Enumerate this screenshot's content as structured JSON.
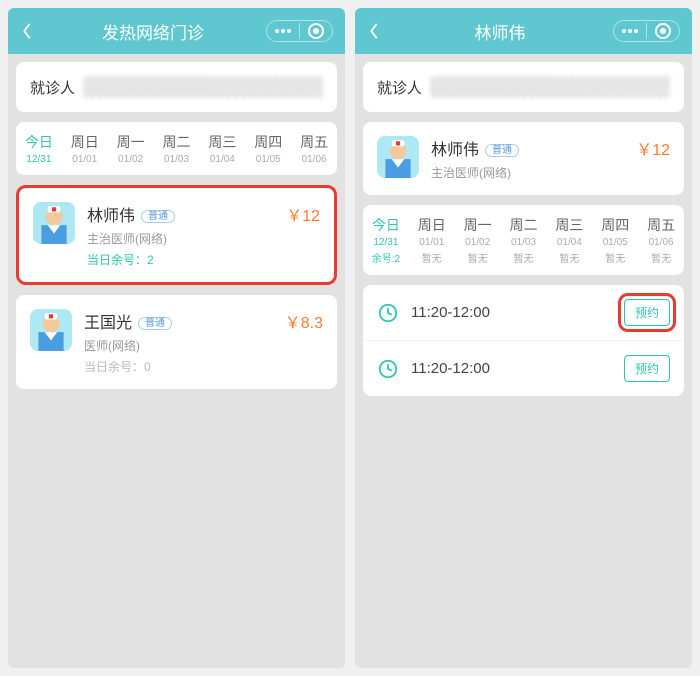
{
  "left": {
    "title": "发热网络门诊",
    "patient_label": "就诊人",
    "days": [
      {
        "label": "今日",
        "date": "12/31",
        "today": true
      },
      {
        "label": "周日",
        "date": "01/01"
      },
      {
        "label": "周一",
        "date": "01/02"
      },
      {
        "label": "周二",
        "date": "01/03"
      },
      {
        "label": "周三",
        "date": "01/04"
      },
      {
        "label": "周四",
        "date": "01/05"
      },
      {
        "label": "周五",
        "date": "01/06"
      }
    ],
    "doctors": [
      {
        "name": "林师伟",
        "tag": "普通",
        "title": "主治医师(网络)",
        "remain": "当日余号：2",
        "price": "￥12",
        "hl": true,
        "remain_grey": false
      },
      {
        "name": "王国光",
        "tag": "普通",
        "title": "医师(网络)",
        "remain": "当日余号：0",
        "price": "￥8.3",
        "hl": false,
        "remain_grey": true
      }
    ]
  },
  "right": {
    "title": "林师伟",
    "patient_label": "就诊人",
    "doctor": {
      "name": "林师伟",
      "tag": "普通",
      "title": "主治医师(网络)",
      "price": "￥12"
    },
    "days": [
      {
        "label": "今日",
        "date": "12/31",
        "avail": "余号:2",
        "today": true
      },
      {
        "label": "周日",
        "date": "01/01",
        "avail": "暂无"
      },
      {
        "label": "周一",
        "date": "01/02",
        "avail": "暂无"
      },
      {
        "label": "周二",
        "date": "01/03",
        "avail": "暂无"
      },
      {
        "label": "周三",
        "date": "01/04",
        "avail": "暂无"
      },
      {
        "label": "周四",
        "date": "01/05",
        "avail": "暂无"
      },
      {
        "label": "周五",
        "date": "01/06",
        "avail": "暂无"
      }
    ],
    "slots": [
      {
        "time": "11:20-12:00",
        "btn": "预约",
        "hl": true
      },
      {
        "time": "11:20-12:00",
        "btn": "预约",
        "hl": false
      }
    ]
  }
}
